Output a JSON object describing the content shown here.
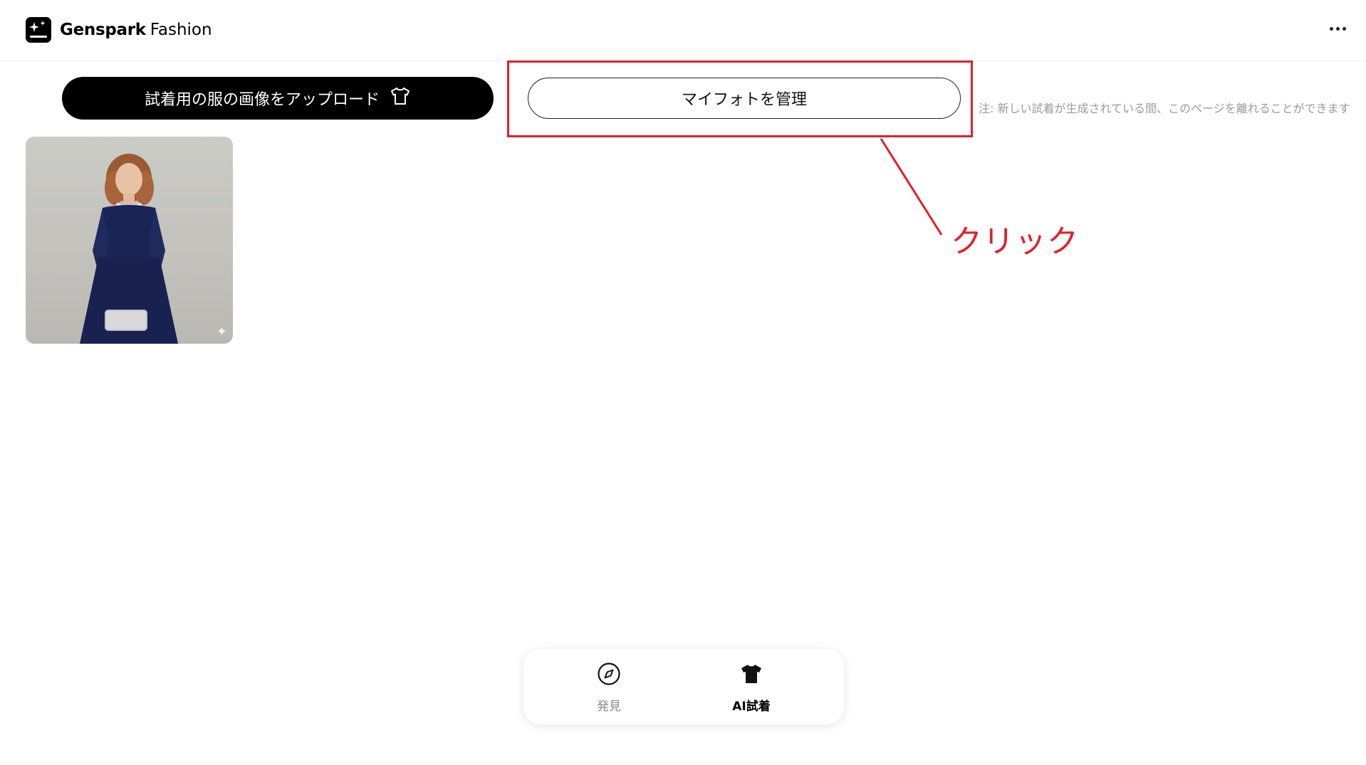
{
  "header": {
    "brand_main": "Genspark",
    "brand_sub": "Fashion",
    "logo_icon": "sparkles-icon",
    "menu_icon": "more-horizontal-icon"
  },
  "toolbar": {
    "upload_label": "試着用の服の画像をアップロード",
    "upload_icon": "tshirt-outline-icon",
    "manage_label": "マイフォトを管理",
    "note": "注: 新しい試着が生成されている間、このページを離れることができます"
  },
  "annotation": {
    "label": "クリック",
    "color": "#e0202b"
  },
  "gallery": {
    "photos": [
      {
        "alt_icon": "sparkle-icon"
      }
    ]
  },
  "bottom_nav": {
    "items": [
      {
        "label": "発見",
        "icon": "compass-icon",
        "active": false
      },
      {
        "label": "AI試着",
        "icon": "tshirt-filled-icon",
        "active": true
      }
    ]
  }
}
